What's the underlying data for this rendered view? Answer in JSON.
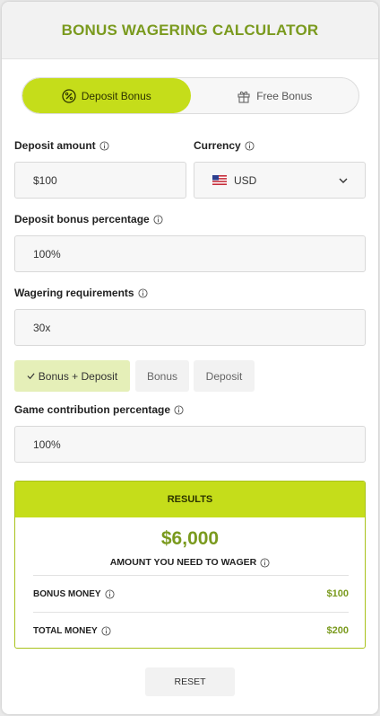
{
  "header": {
    "title": "BONUS WAGERING CALCULATOR"
  },
  "mode_toggle": {
    "deposit_bonus": "Deposit Bonus",
    "free_bonus": "Free Bonus"
  },
  "deposit_amount": {
    "label": "Deposit amount",
    "value": "$100"
  },
  "currency": {
    "label": "Currency",
    "value": "USD"
  },
  "bonus_percentage": {
    "label": "Deposit bonus percentage",
    "value": "100%"
  },
  "wagering": {
    "label": "Wagering requirements",
    "value": "30x",
    "options": [
      "Bonus + Deposit",
      "Bonus",
      "Deposit"
    ],
    "selected": "Bonus + Deposit"
  },
  "game_contribution": {
    "label": "Game contribution percentage",
    "value": "100%"
  },
  "results": {
    "title": "RESULTS",
    "amount": "$6,000",
    "amount_label": "AMOUNT YOU NEED TO WAGER",
    "bonus_money_label": "BONUS MONEY",
    "bonus_money_value": "$100",
    "total_money_label": "TOTAL MONEY",
    "total_money_value": "$200"
  },
  "reset_label": "RESET",
  "colors": {
    "accent": "#c5dd1a",
    "accent_text": "#7a9a1e",
    "chip_active": "#e5efb8"
  }
}
